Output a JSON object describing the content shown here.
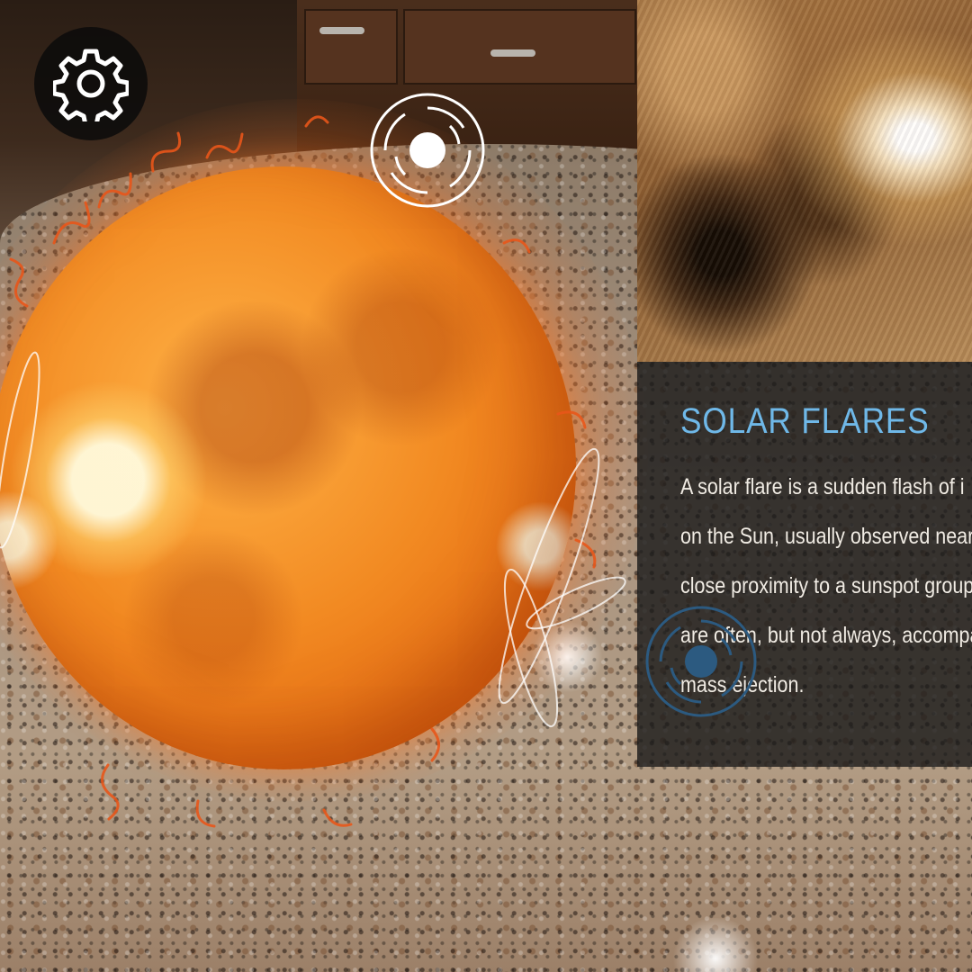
{
  "scene": {
    "accent_color": "#6fb8e8",
    "sun_color": "#f28a22"
  },
  "toolbar": {
    "settings_icon": "gear-icon"
  },
  "markers": [
    {
      "icon": "target-marker-icon",
      "color": "#ffffff"
    },
    {
      "icon": "target-marker-icon",
      "color": "#2c5a80"
    }
  ],
  "info_panel": {
    "title": "SOLAR FLARES",
    "body_lines": [
      "A solar flare is a sudden flash of i",
      "on the Sun, usually observed near",
      "close proximity to a sunspot group",
      "are often, but not always, accompa",
      "mass ejection."
    ]
  }
}
